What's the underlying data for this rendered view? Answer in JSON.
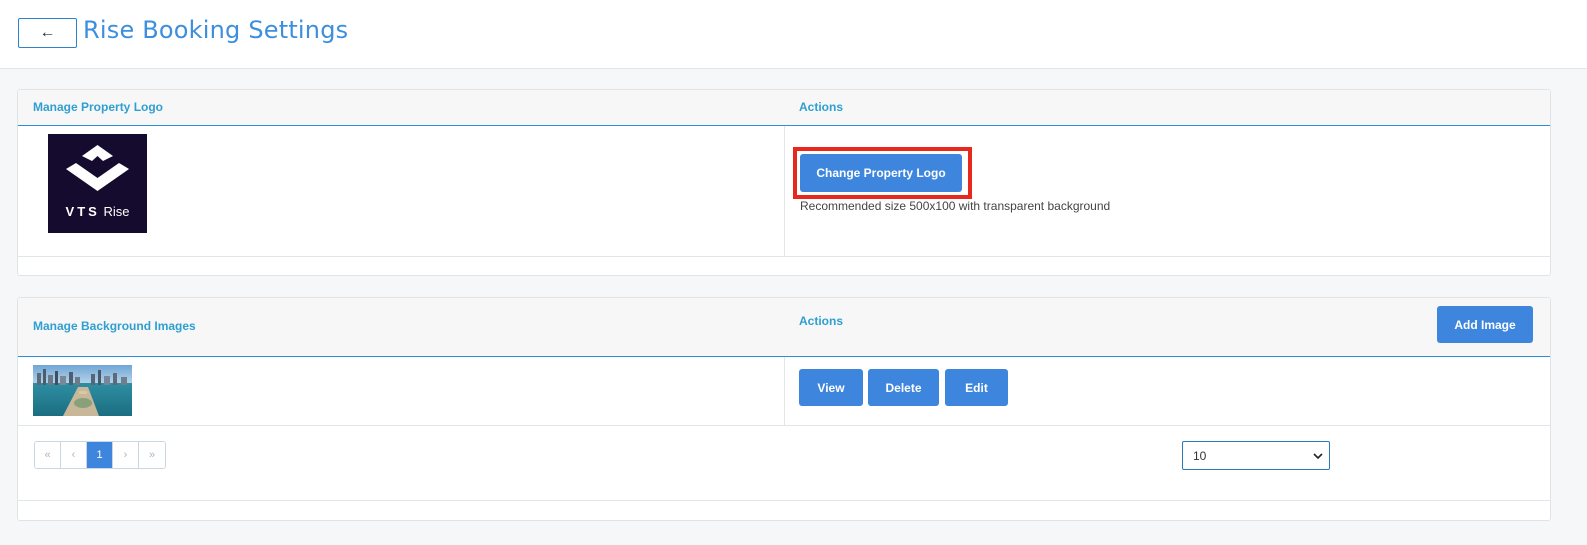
{
  "header": {
    "back_label": "←",
    "title": "Rise Booking Settings"
  },
  "logo_panel": {
    "col1_header": "Manage Property Logo",
    "col2_header": "Actions",
    "logo_text_bold": "VTS",
    "logo_text": "Rise",
    "change_button": "Change Property Logo",
    "hint": "Recommended size 500x100 with transparent background"
  },
  "images_panel": {
    "col1_header": "Manage Background Images",
    "col2_header": "Actions",
    "add_button": "Add Image",
    "rows": [
      {
        "view": "View",
        "delete": "Delete",
        "edit": "Edit"
      }
    ],
    "pagination": {
      "first": "«",
      "prev": "‹",
      "current": "1",
      "next": "›",
      "last": "»"
    },
    "page_size": "10"
  },
  "colors": {
    "accent": "#3e86dd",
    "header_text": "#2f9fd0",
    "highlight": "#e8271d",
    "logo_bg": "#150b2e"
  }
}
